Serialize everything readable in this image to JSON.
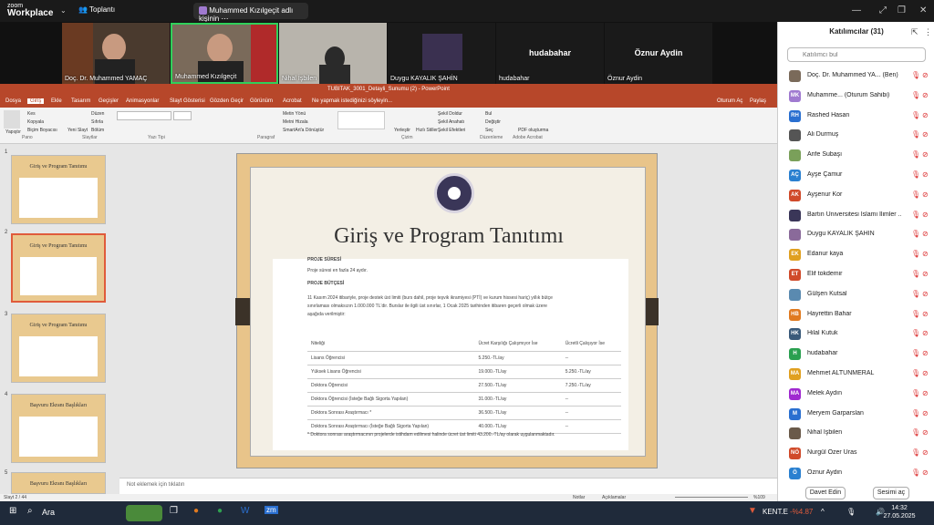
{
  "zoom": {
    "logo_line1": "zoom",
    "logo_line2": "Workplace",
    "meeting_label": "Toplantı",
    "share_label": "Muhammed Kızılgeçit adlı kişinin"
  },
  "videos": [
    {
      "name": "Doç. Dr. Muhammed YAMAÇ"
    },
    {
      "name": "Muhammed Kızılgeçit"
    },
    {
      "name": "Nihal İşbilen"
    },
    {
      "name": "Duygu KAYALIK ŞAHİN"
    },
    {
      "name": "hudabahar",
      "big": "hudabahar"
    },
    {
      "name": "Öznur Aydin",
      "big": "Öznur Aydin"
    }
  ],
  "participants_panel": {
    "title": "Katılımcılar (31)",
    "search_placeholder": "Katılımcı bul",
    "invite_label": "Davet Edin",
    "mute_label": "Sesimi aç",
    "items": [
      {
        "initials": "",
        "name": "Doç. Dr. Muhammed YA... (Ben)",
        "color": "#7a6a5a"
      },
      {
        "initials": "MK",
        "name": "Muhamme... (Oturum Sahibi)",
        "color": "#a07ad0"
      },
      {
        "initials": "RH",
        "name": "Rashed Hasan",
        "color": "#2a6fd0"
      },
      {
        "initials": "",
        "name": "Ali Durmuş",
        "color": "#555"
      },
      {
        "initials": "",
        "name": "Arife Subaşı",
        "color": "#7aa05a"
      },
      {
        "initials": "AÇ",
        "name": "Ayşe Çamur",
        "color": "#2a80d0"
      },
      {
        "initials": "AK",
        "name": "Ayşenur Kor",
        "color": "#d04a2a"
      },
      {
        "initials": "",
        "name": "Bartın Üniversitesi İslami İlimler ...",
        "color": "#3a3658"
      },
      {
        "initials": "",
        "name": "Duygu KAYALIK ŞAHİN",
        "color": "#8a6a9a"
      },
      {
        "initials": "EK",
        "name": "Edanur kaya",
        "color": "#e0a020"
      },
      {
        "initials": "ET",
        "name": "Elif tokdemir",
        "color": "#d04a2a"
      },
      {
        "initials": "",
        "name": "Gülşen Kutsal",
        "color": "#5a8ab0"
      },
      {
        "initials": "HB",
        "name": "Hayrettin Bahar",
        "color": "#e07a20"
      },
      {
        "initials": "HK",
        "name": "Hilal Kutuk",
        "color": "#3a5a7a"
      },
      {
        "initials": "H",
        "name": "hudabahar",
        "color": "#2aa050"
      },
      {
        "initials": "MA",
        "name": "Mehmet ALTUNMERAL",
        "color": "#e0a020"
      },
      {
        "initials": "MA",
        "name": "Melek Aydın",
        "color": "#a02ad0"
      },
      {
        "initials": "M",
        "name": "Meryem Garparslan",
        "color": "#2a6fd0"
      },
      {
        "initials": "",
        "name": "Nihal İşbilen",
        "color": "#6a5a4a"
      },
      {
        "initials": "NÖ",
        "name": "Nurgül Özer Uras",
        "color": "#d04a2a"
      },
      {
        "initials": "Ö",
        "name": "Öznur Aydin",
        "color": "#2a80d0"
      }
    ]
  },
  "ppt": {
    "title": "TUBITAK_3001_Detayli_Sunumu (2) - PowerPoint",
    "tabs": [
      "Dosya",
      "Giriş",
      "Ekle",
      "Tasarım",
      "Geçişler",
      "Animasyonlar",
      "Slayt Gösterisi",
      "Gözden Geçir",
      "Görünüm",
      "Acrobat",
      "Ne yapmak istediğinizi söyleyin..."
    ],
    "right_tabs": [
      "Oturum Aç",
      "Paylaş"
    ],
    "groups": [
      "Pano",
      "Slaytlar",
      "Yazı Tipi",
      "Paragraf",
      "Çizim",
      "Düzenleme",
      "Adobe Acrobat"
    ],
    "ribbon_items": [
      "Kes",
      "Kopyala",
      "Biçim Boyacısı",
      "Yapıştır",
      "Düzen",
      "Sıfırla",
      "Bölüm",
      "Yeni Slayt",
      "Metin Yönü",
      "Metni Hizala",
      "SmartArt'a Dönüştür",
      "Şekil Doldur",
      "Şekil Anahatı",
      "Şekil Efektleri",
      "Yerleştir",
      "Hızlı Stiller",
      "Bul",
      "Değiştir",
      "Seç",
      "PDF oluşturma"
    ],
    "thumbs": [
      {
        "num": "1",
        "title": "Giriş ve Program Tanıtımı"
      },
      {
        "num": "2",
        "title": "Giriş ve Program Tanıtımı"
      },
      {
        "num": "3",
        "title": "Giriş ve Program Tanıtımı"
      },
      {
        "num": "4",
        "title": "Başvuru Ekranı Başlıkları"
      },
      {
        "num": "5",
        "title": "Başvuru Ekranı Başlıkları"
      }
    ],
    "slide": {
      "title": "Giriş ve Program Tanıtımı",
      "h1": "PROJE SÜRESİ",
      "p1": "Proje süresi en fazla 24 aydır.",
      "h2": "PROJE BÜTÇESİ",
      "p2": "11 Kasım 2024 itibariyle, proje destek üst limiti (burs dahil, proje teşvik ikramiyesi (PTİ) ve kurum hissesi hariç) yıllık bütçe",
      "p3": "sınırlaması olmaksızın 1.000.000 TL'dir. Burslar ile ilgili üst sınırlar, 1 Ocak 2025 tarihinden itibaren geçerli olmak üzere",
      "p4": "aşağıda verilmiştir:",
      "table_header": [
        "Niteliği",
        "Ücret Karşılığı Çalışmıyor İse",
        "Ücretli Çalışıyor İse"
      ],
      "table_rows": [
        [
          "Lisans Öğrencisi",
          "5.250.-TL/ay",
          "--"
        ],
        [
          "Yüksek Lisans Öğrencisi",
          "19.000.-TL/ay",
          "5.250.-TL/ay"
        ],
        [
          "Doktora Öğrencisi",
          "27.500.-TL/ay",
          "7.250.-TL/ay"
        ],
        [
          "Doktora Öğrencisi (İsteğe Bağlı Sigorta Yapılan)",
          "31.000.-TL/ay",
          "--"
        ],
        [
          "Doktora Sonrası Araştırmacı *",
          "36.500.-TL/ay",
          "--"
        ],
        [
          "Doktora Sonrası Araştırmacı (İsteğe Bağlı Sigorta Yapılan)",
          "40.000.-TL/ay",
          "--"
        ]
      ],
      "footnote": "* Doktora sonrası araştırmacının projelerde istihdam edilmesi halinde ücret üst limiti 43.200.-TL/ay olarak uygulanmaktadır."
    },
    "notes_placeholder": "Not eklemek için tıklatın",
    "status_left": "Slayt 2 / 44",
    "status_notes": "Notlar",
    "status_comments": "Açıklamalar",
    "zoom_level": "%109"
  },
  "taskbar": {
    "search_label": "Ara",
    "stock_name": "KENT.E",
    "stock_change": "-%4.87",
    "time": "14:32",
    "date": "27.05.2025"
  }
}
